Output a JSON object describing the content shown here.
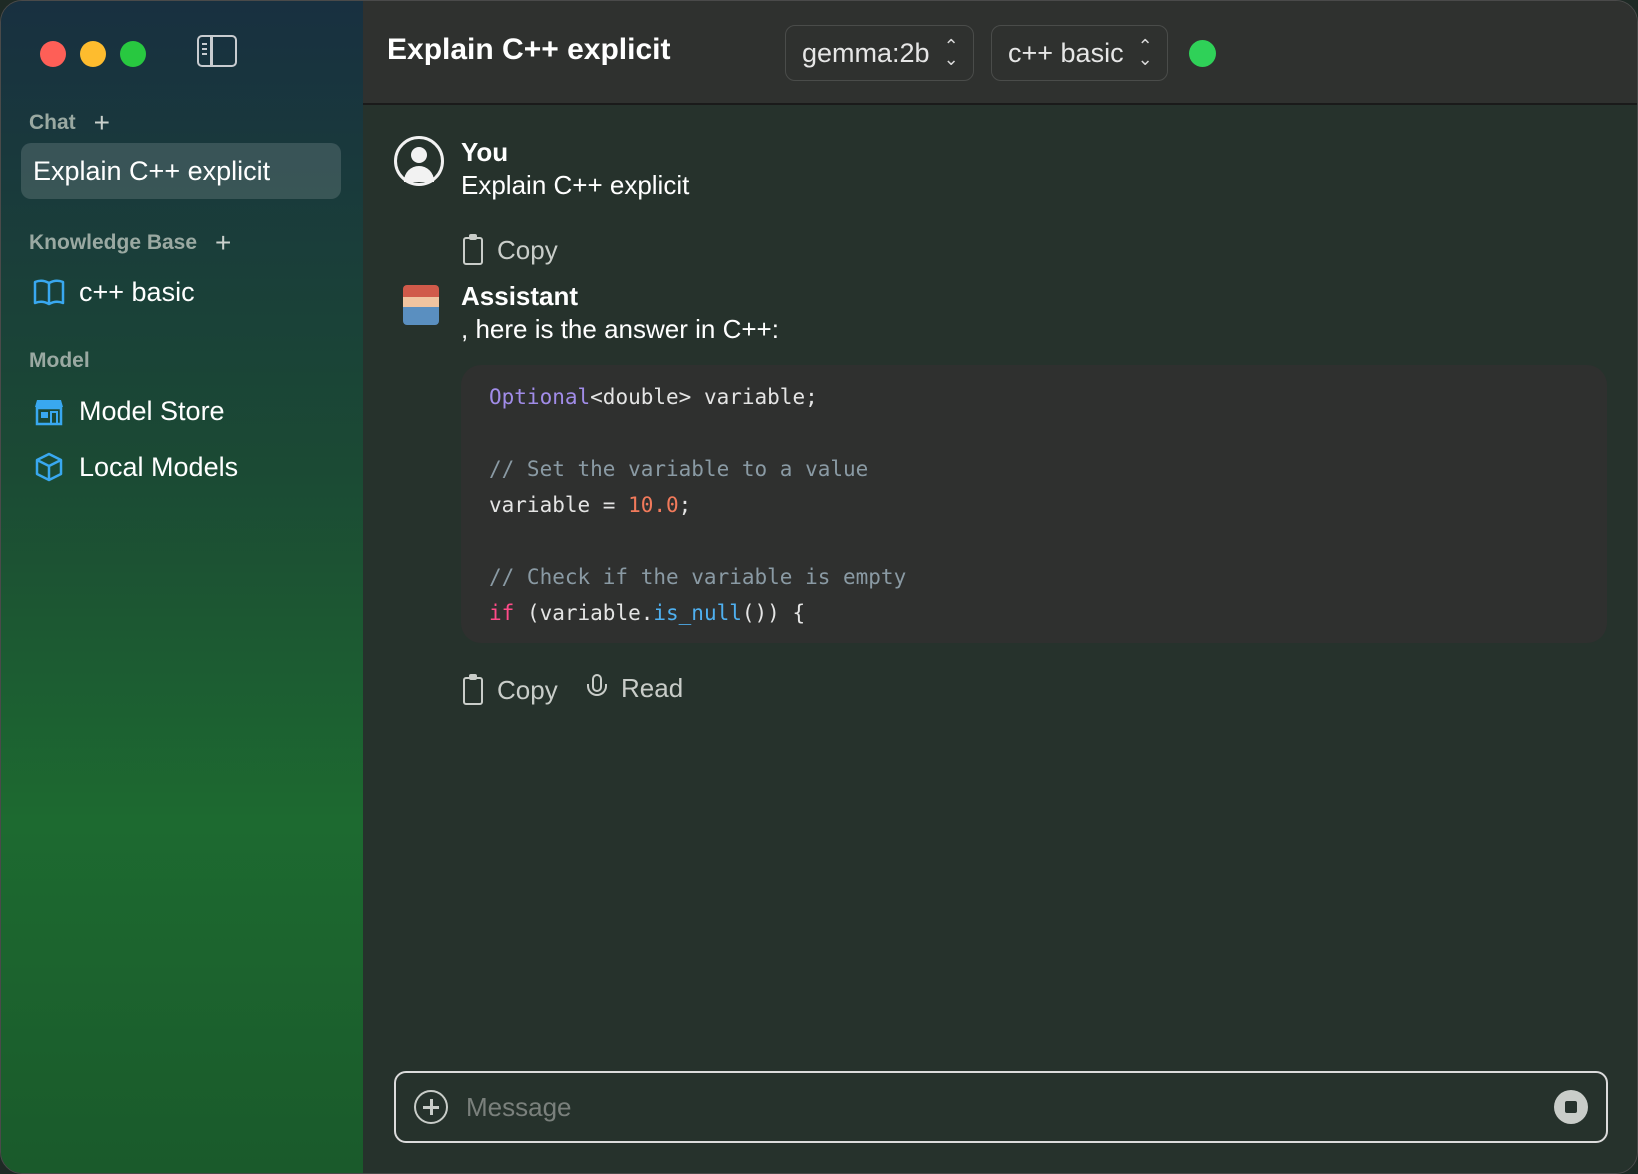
{
  "sidebar": {
    "chat_section": "Chat",
    "chat_items": [
      {
        "label": "Explain C++ explicit"
      }
    ],
    "kb_section": "Knowledge Base",
    "kb_items": [
      {
        "label": "c++ basic",
        "icon": "book-icon"
      }
    ],
    "model_section": "Model",
    "model_items": [
      {
        "label": "Model Store",
        "icon": "store-icon"
      },
      {
        "label": "Local Models",
        "icon": "cube-icon"
      }
    ]
  },
  "header": {
    "title": "Explain C++ explicit",
    "model_picker": "gemma:2b",
    "kb_picker": "c++ basic",
    "status_color": "#2fd158"
  },
  "messages": [
    {
      "role": "You",
      "text": "Explain C++ explicit",
      "actions": [
        "Copy"
      ]
    },
    {
      "role": "Assistant",
      "text": ", here is the answer in C++:",
      "code": [
        "Optional<double> variable;",
        "",
        "// Set the variable to a value",
        "variable = 10.0;",
        "",
        "// Check if the variable is empty",
        "if (variable.is_null()) {"
      ],
      "actions": [
        "Copy",
        "Read"
      ]
    }
  ],
  "composer": {
    "placeholder": "Message"
  },
  "colors": {
    "accent_keyword": "#a18ce8",
    "control": "#ff4b88",
    "number": "#f27a5b",
    "function": "#4fb0f0"
  }
}
